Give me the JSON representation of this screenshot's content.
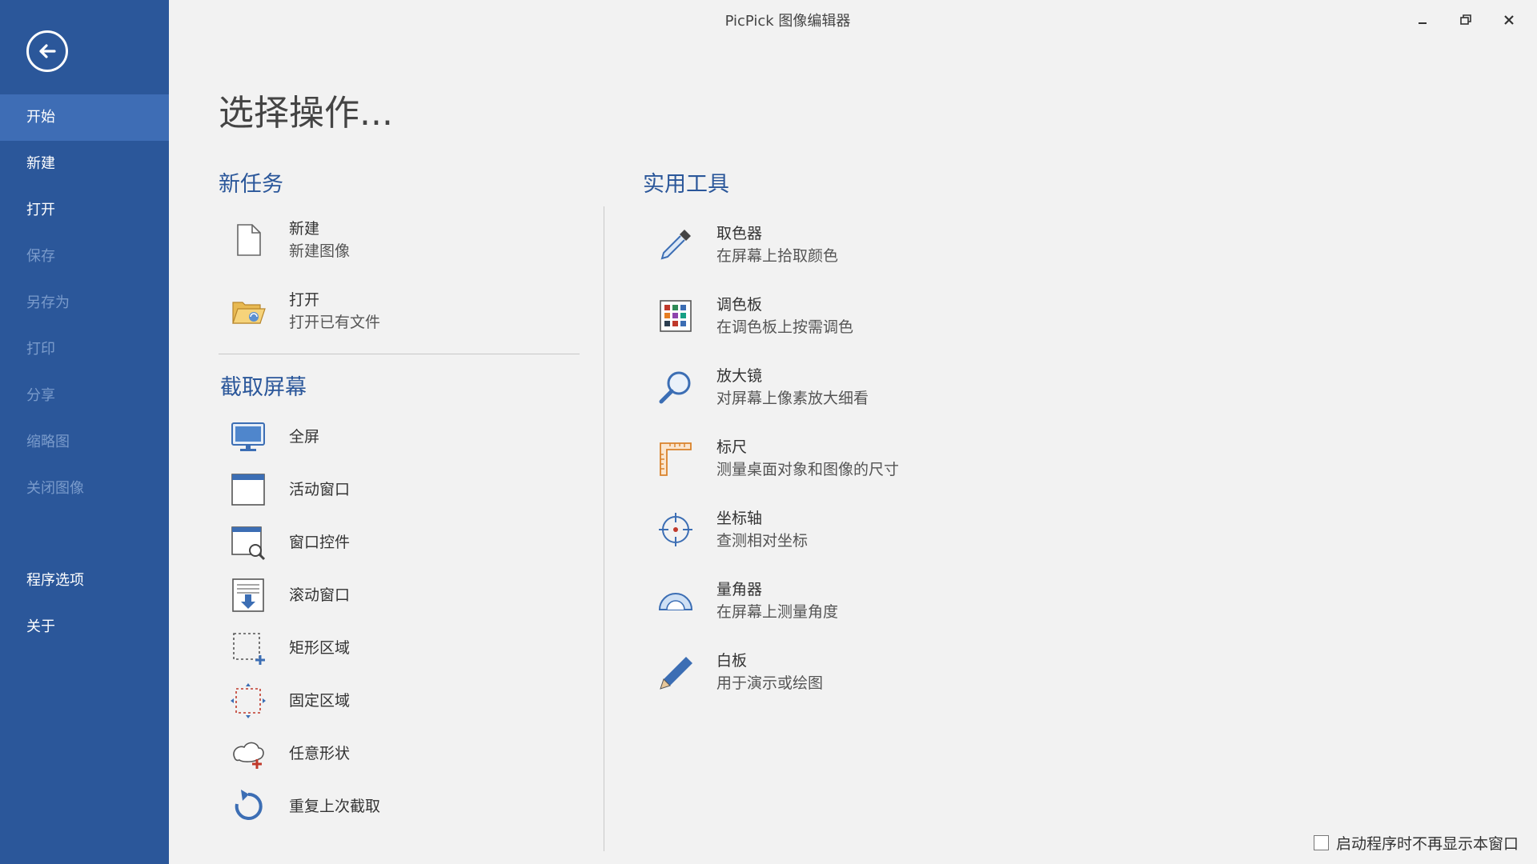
{
  "window": {
    "title": "PicPick 图像编辑器"
  },
  "sidebar": {
    "items": [
      {
        "label": "开始",
        "state": "active"
      },
      {
        "label": "新建",
        "state": "enabled"
      },
      {
        "label": "打开",
        "state": "enabled"
      },
      {
        "label": "保存",
        "state": "disabled"
      },
      {
        "label": "另存为",
        "state": "disabled"
      },
      {
        "label": "打印",
        "state": "disabled"
      },
      {
        "label": "分享",
        "state": "disabled"
      },
      {
        "label": "缩略图",
        "state": "disabled"
      },
      {
        "label": "关闭图像",
        "state": "disabled"
      },
      {
        "label": "程序选项",
        "state": "enabled"
      },
      {
        "label": "关于",
        "state": "enabled"
      }
    ]
  },
  "main": {
    "title": "选择操作...",
    "new_task": {
      "heading": "新任务",
      "items": [
        {
          "label": "新建",
          "desc": "新建图像",
          "icon": "new-file-icon"
        },
        {
          "label": "打开",
          "desc": "打开已有文件",
          "icon": "open-folder-icon"
        }
      ]
    },
    "capture": {
      "heading": "截取屏幕",
      "items": [
        {
          "label": "全屏",
          "icon": "monitor-icon"
        },
        {
          "label": "活动窗口",
          "icon": "window-icon"
        },
        {
          "label": "窗口控件",
          "icon": "window-control-icon"
        },
        {
          "label": "滚动窗口",
          "icon": "scroll-window-icon"
        },
        {
          "label": "矩形区域",
          "icon": "rect-region-icon"
        },
        {
          "label": "固定区域",
          "icon": "fixed-region-icon"
        },
        {
          "label": "任意形状",
          "icon": "freehand-shape-icon"
        },
        {
          "label": "重复上次截取",
          "icon": "repeat-icon"
        }
      ]
    },
    "tools": {
      "heading": "实用工具",
      "items": [
        {
          "label": "取色器",
          "desc": "在屏幕上拾取颜色",
          "icon": "eyedropper-icon"
        },
        {
          "label": "调色板",
          "desc": "在调色板上按需调色",
          "icon": "palette-icon"
        },
        {
          "label": "放大镜",
          "desc": "对屏幕上像素放大细看",
          "icon": "magnifier-icon"
        },
        {
          "label": "标尺",
          "desc": "测量桌面对象和图像的尺寸",
          "icon": "ruler-icon"
        },
        {
          "label": "坐标轴",
          "desc": "查测相对坐标",
          "icon": "crosshair-icon"
        },
        {
          "label": "量角器",
          "desc": "在屏幕上测量角度",
          "icon": "protractor-icon"
        },
        {
          "label": "白板",
          "desc": "用于演示或绘图",
          "icon": "pen-icon"
        }
      ]
    }
  },
  "footer": {
    "startup_checkbox_label": "启动程序时不再显示本窗口",
    "checked": false
  },
  "colors": {
    "sidebar": "#2b579a",
    "sidebar_active": "#3e6db5",
    "accent": "#2b579a",
    "background": "#f2f2f2"
  }
}
